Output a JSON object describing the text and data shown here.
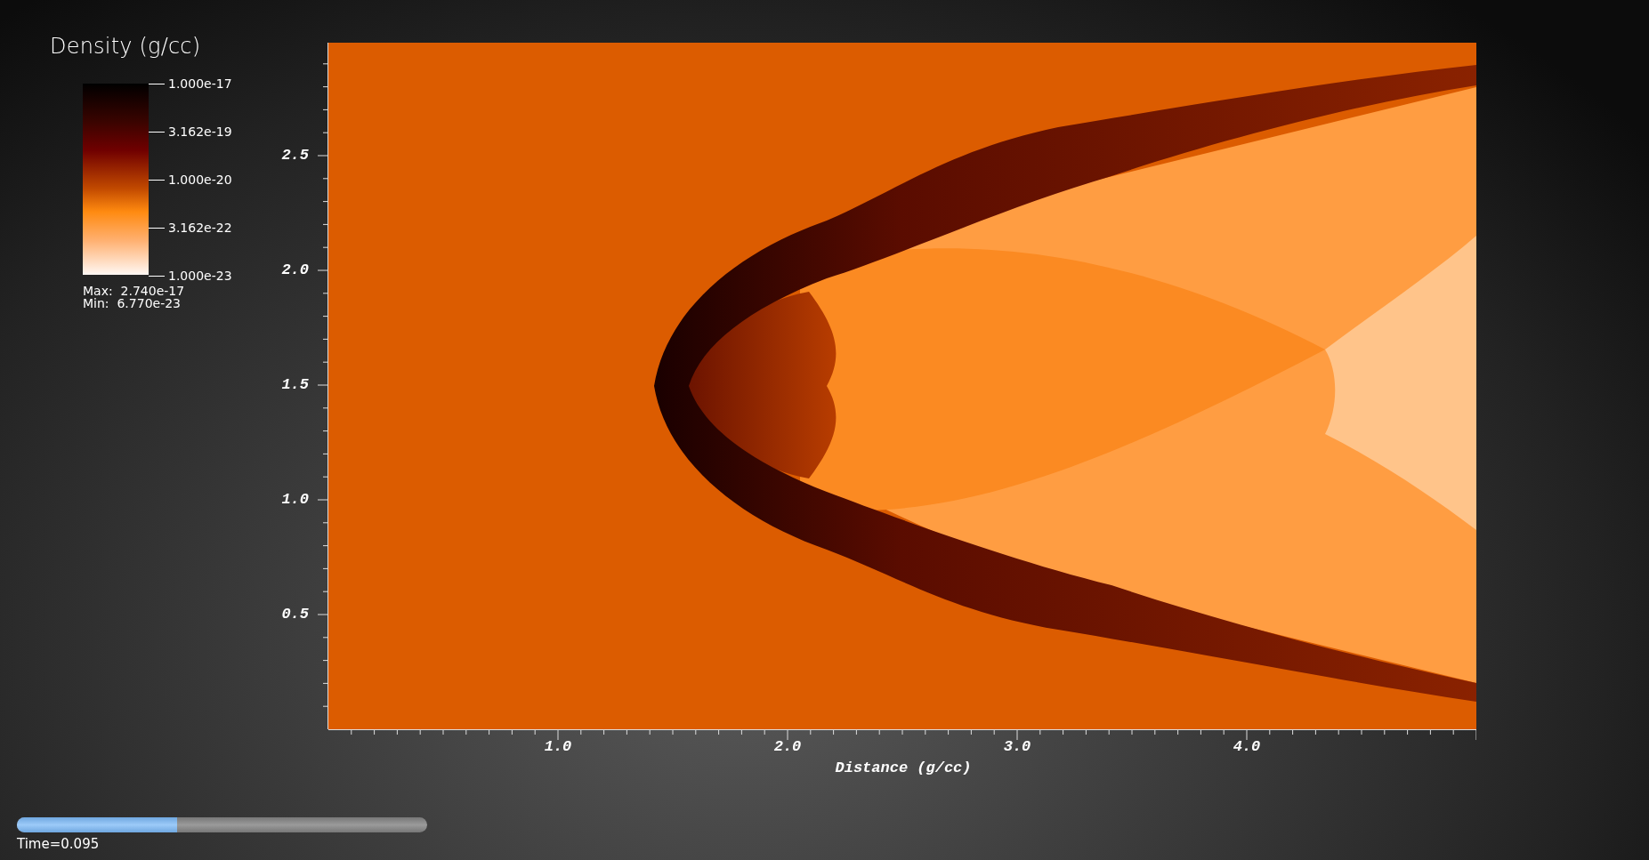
{
  "legend": {
    "title": "Density (g/cc)",
    "ticks": [
      "1.000e-17",
      "3.162e-19",
      "1.000e-20",
      "3.162e-22",
      "1.000e-23"
    ],
    "max": "Max:  2.740e-17",
    "min": "Min:  6.770e-23"
  },
  "plot": {
    "y_ticks": [
      "2.5",
      "2.0",
      "1.5",
      "1.0",
      "0.5"
    ],
    "x_ticks": [
      "1.0",
      "2.0",
      "3.0",
      "4.0"
    ],
    "xlabel": "Distance (g/cc)"
  },
  "time_slider": {
    "level": 0.39,
    "label": "Time=0.095"
  }
}
